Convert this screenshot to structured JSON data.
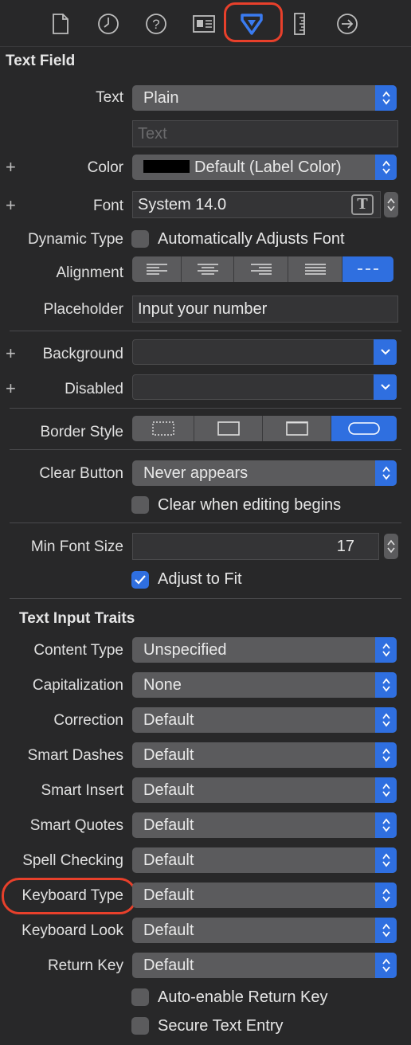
{
  "toolbar": {
    "icons": [
      "file-icon",
      "clock-icon",
      "help-icon",
      "identity-icon",
      "attributes-icon",
      "ruler-icon",
      "connections-icon"
    ],
    "active": "attributes-icon"
  },
  "text_field": {
    "section_title": "Text Field",
    "text_label": "Text",
    "text_value": "Plain",
    "text_placeholder": "Text",
    "color_label": "Color",
    "color_value": "Default (Label Color)",
    "font_label": "Font",
    "font_value": "System 14.0",
    "dynamic_type_label": "Dynamic Type",
    "dynamic_type_check": "Automatically Adjusts Font",
    "alignment_label": "Alignment",
    "placeholder_label": "Placeholder",
    "placeholder_value": "Input your number",
    "background_label": "Background",
    "disabled_label": "Disabled",
    "border_style_label": "Border Style",
    "clear_button_label": "Clear Button",
    "clear_button_value": "Never appears",
    "clear_when_editing": "Clear when editing begins",
    "min_font_size_label": "Min Font Size",
    "min_font_size_value": "17",
    "adjust_to_fit": "Adjust to Fit"
  },
  "text_input_traits": {
    "section_title": "Text Input Traits",
    "rows": [
      {
        "label": "Content Type",
        "value": "Unspecified"
      },
      {
        "label": "Capitalization",
        "value": "None"
      },
      {
        "label": "Correction",
        "value": "Default"
      },
      {
        "label": "Smart Dashes",
        "value": "Default"
      },
      {
        "label": "Smart Insert",
        "value": "Default"
      },
      {
        "label": "Smart Quotes",
        "value": "Default"
      },
      {
        "label": "Spell Checking",
        "value": "Default"
      },
      {
        "label": "Keyboard Type",
        "value": "Default"
      },
      {
        "label": "Keyboard Look",
        "value": "Default"
      },
      {
        "label": "Return Key",
        "value": "Default"
      }
    ],
    "auto_enable_return_key": "Auto-enable Return Key",
    "secure_text_entry": "Secure Text Entry"
  },
  "colors": {
    "accent": "#2f6fe0",
    "highlight": "#e8402b",
    "background": "#282829"
  }
}
